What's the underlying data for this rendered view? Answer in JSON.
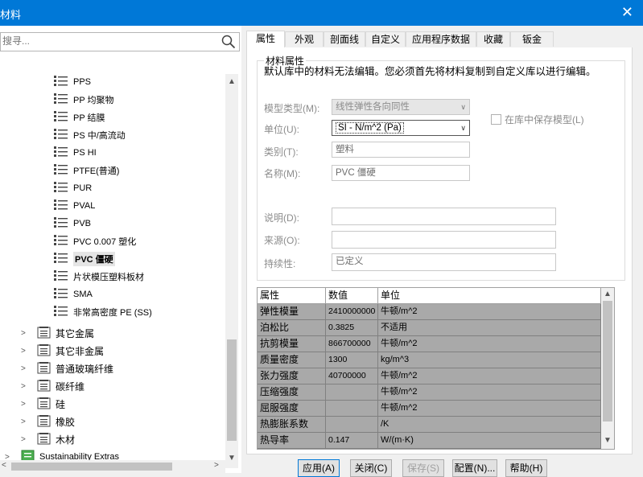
{
  "window": {
    "title": "材料",
    "close_glyph": "✕"
  },
  "search": {
    "placeholder": "搜寻..."
  },
  "tree": {
    "materials": [
      {
        "label": "PPS"
      },
      {
        "label": "PP 均聚物"
      },
      {
        "label": "PP 结膜"
      },
      {
        "label": "PS 中/高流动"
      },
      {
        "label": "PS HI"
      },
      {
        "label": "PTFE(普通)"
      },
      {
        "label": "PUR"
      },
      {
        "label": "PVAL"
      },
      {
        "label": "PVB"
      },
      {
        "label": "PVC 0.007 塑化"
      },
      {
        "label": "PVC 僵硬",
        "selected": true
      },
      {
        "label": "片状模压塑料板材"
      },
      {
        "label": "SMA"
      },
      {
        "label": "非常高密度 PE (SS)"
      }
    ],
    "folders": [
      {
        "label": "其它金属"
      },
      {
        "label": "其它非金属"
      },
      {
        "label": "普通玻璃纤维"
      },
      {
        "label": "碳纤维"
      },
      {
        "label": "硅"
      },
      {
        "label": "橡胶"
      },
      {
        "label": "木材"
      }
    ],
    "library": {
      "label": "Sustainability Extras"
    }
  },
  "tabs": [
    {
      "label": "属性",
      "active": true
    },
    {
      "label": "外观"
    },
    {
      "label": "剖面线"
    },
    {
      "label": "自定义"
    },
    {
      "label": "应用程序数据"
    },
    {
      "label": "收藏"
    },
    {
      "label": "钣金"
    }
  ],
  "properties": {
    "group_title": "材料属性",
    "notice": "默认库中的材料无法编辑。您必须首先将材料复制到自定义库以进行编辑。",
    "model_type": {
      "label": "模型类型(M):",
      "value": "线性弹性各向同性"
    },
    "save_in_library": {
      "label": "在库中保存模型(L)"
    },
    "units": {
      "label": "单位(U):",
      "value": "SI - N/m^2 (Pa)"
    },
    "category": {
      "label": "类别(T):",
      "value": "塑料"
    },
    "name": {
      "label": "名称(M):",
      "value": "PVC 僵硬"
    },
    "description": {
      "label": "说明(D):",
      "value": ""
    },
    "source": {
      "label": "来源(O):",
      "value": ""
    },
    "sustainability": {
      "label": "持续性:",
      "value": "已定义"
    }
  },
  "table": {
    "headers": {
      "property": "属性",
      "value": "数值",
      "unit": "单位"
    },
    "rows": [
      {
        "property": "弹性模量",
        "value": "2410000000",
        "unit": "牛顿/m^2"
      },
      {
        "property": "泊松比",
        "value": "0.3825",
        "unit": "不适用"
      },
      {
        "property": "抗剪模量",
        "value": "866700000",
        "unit": "牛顿/m^2"
      },
      {
        "property": "质量密度",
        "value": "1300",
        "unit": "kg/m^3"
      },
      {
        "property": "张力强度",
        "value": "40700000",
        "unit": "牛顿/m^2"
      },
      {
        "property": "压缩强度",
        "value": "",
        "unit": "牛顿/m^2"
      },
      {
        "property": "屈服强度",
        "value": "",
        "unit": "牛顿/m^2"
      },
      {
        "property": "热膨胀系数",
        "value": "",
        "unit": "/K"
      },
      {
        "property": "热导率",
        "value": "0.147",
        "unit": "W/(m·K)"
      }
    ]
  },
  "buttons": {
    "apply": "应用(A)",
    "close": "关闭(C)",
    "save": "保存(S)",
    "config": "配置(N)...",
    "help": "帮助(H)"
  }
}
